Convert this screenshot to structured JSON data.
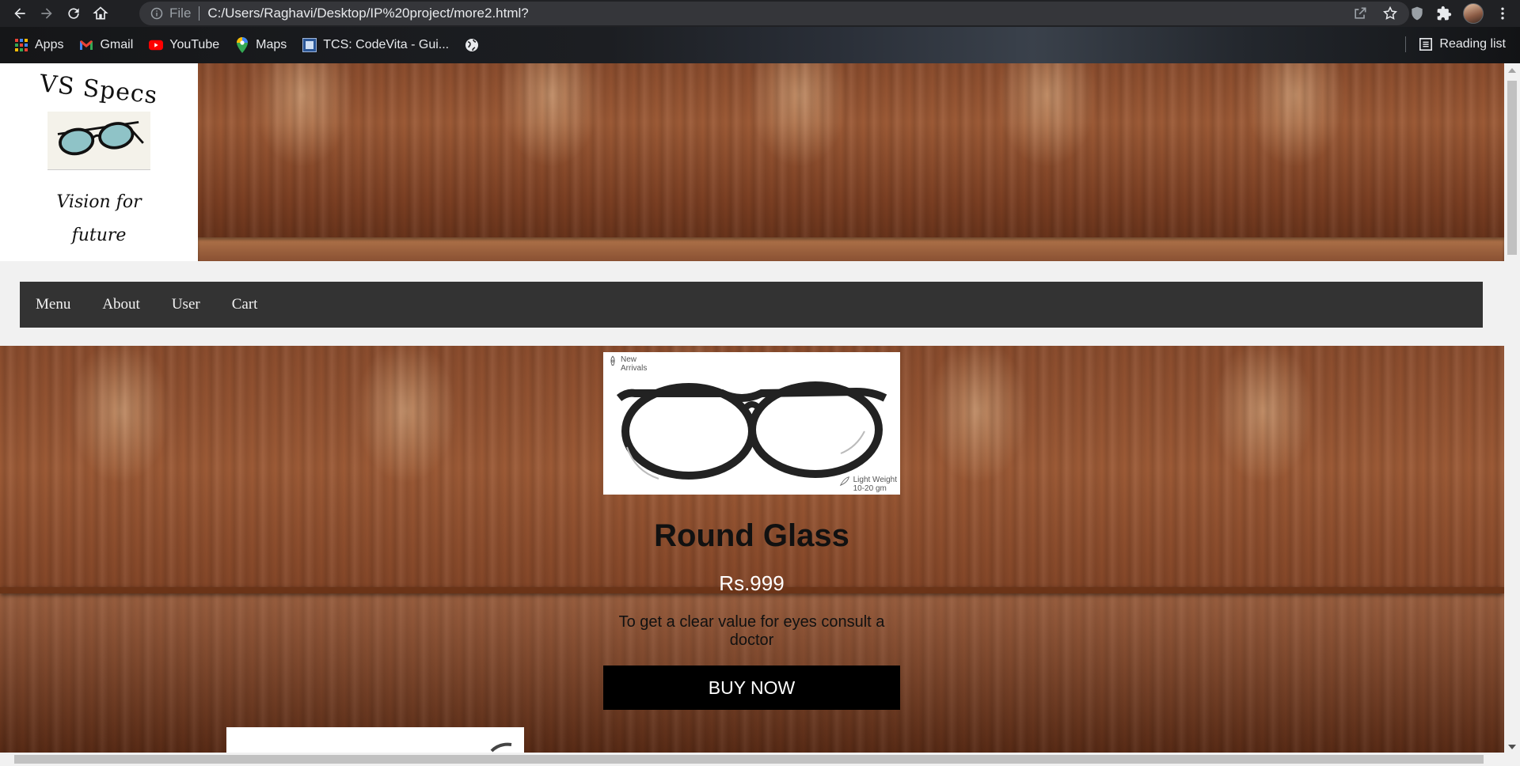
{
  "browser": {
    "scheme": "File",
    "url": "C:/Users/Raghavi/Desktop/IP%20project/more2.html?",
    "icons": [
      "back-icon",
      "forward-icon",
      "reload-icon",
      "home-icon",
      "info-icon",
      "share-icon",
      "star-icon",
      "shield-icon",
      "puzzle-icon",
      "menu-icon"
    ]
  },
  "bookmarks": {
    "items": [
      {
        "label": "Apps",
        "icon": "apps-grid-icon"
      },
      {
        "label": "Gmail",
        "icon": "gmail-icon"
      },
      {
        "label": "YouTube",
        "icon": "youtube-icon"
      },
      {
        "label": "Maps",
        "icon": "maps-icon"
      },
      {
        "label": "TCS: CodeVita - Gui...",
        "icon": "codevita-icon"
      },
      {
        "label": "",
        "icon": "globe-icon"
      }
    ],
    "reading_list": "Reading list"
  },
  "site": {
    "brand": "VS Specs",
    "tagline": "Vision for future",
    "nav": [
      "Menu",
      "About",
      "User",
      "Cart"
    ]
  },
  "product": {
    "badge_new": "New Arrivals",
    "badge_light_1": "Light Weight",
    "badge_light_2": "10-20 gm",
    "title": "Round Glass",
    "price": "Rs.999",
    "description": "To get a clear value for eyes consult a doctor",
    "buy_label": "BUY NOW"
  },
  "colors": {
    "nav_bg": "#333333",
    "button_bg": "#000000",
    "wood": "#8a4c2d"
  }
}
